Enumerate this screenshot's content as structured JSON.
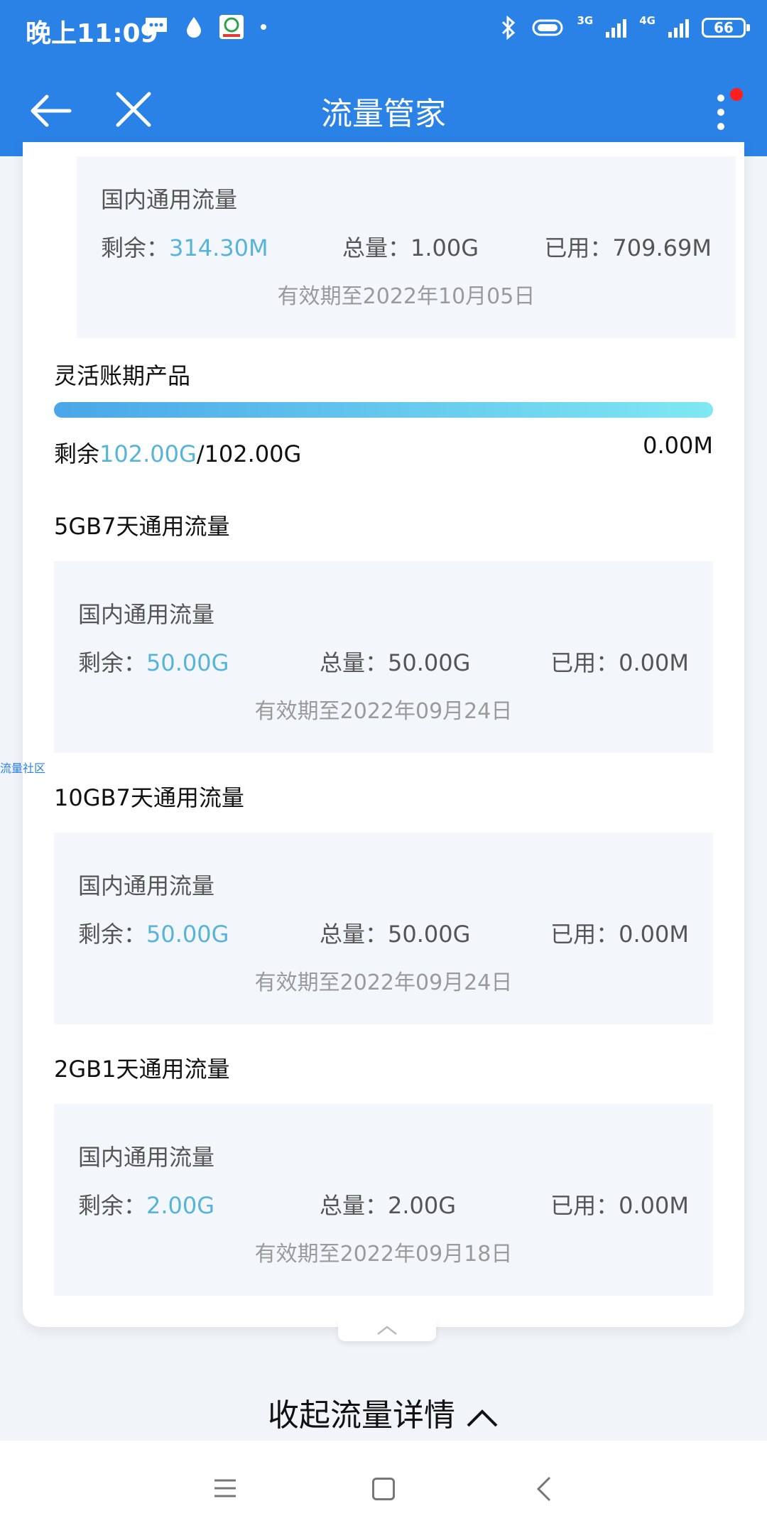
{
  "status_bar": {
    "time": "晚上11:09",
    "network_3g": "3G",
    "network_4g": "4G",
    "battery": "66",
    "icons": [
      "message-icon",
      "drop-icon",
      "app-notification-icon",
      "dot-icon",
      "bluetooth-icon",
      "vibrate-icon",
      "signal-3g-icon",
      "signal-4g-icon",
      "battery-icon"
    ]
  },
  "app_bar": {
    "title": "流量管家"
  },
  "top_package": {
    "type": "国内通用流量",
    "remain_label": "剩余：",
    "remain_value": "314.30M",
    "total": "总量：1.00G",
    "used": "已用：709.69M",
    "validity": "有效期至2022年10月05日"
  },
  "flex_product": {
    "title": "灵活账期产品",
    "progress_remaining_fraction": 1.0,
    "remain_label": "剩余",
    "remain_value": "102.00G",
    "remain_total": "/102.00G",
    "right_value": "0.00M"
  },
  "packages": [
    {
      "title": "5GB7天通用流量",
      "type": "国内通用流量",
      "remain_label": "剩余：",
      "remain_value": "50.00G",
      "total": "总量：50.00G",
      "used": "已用：0.00M",
      "validity": "有效期至2022年09月24日"
    },
    {
      "title": "10GB7天通用流量",
      "type": "国内通用流量",
      "remain_label": "剩余：",
      "remain_value": "50.00G",
      "total": "总量：50.00G",
      "used": "已用：0.00M",
      "validity": "有效期至2022年09月24日"
    },
    {
      "title": "2GB1天通用流量",
      "type": "国内通用流量",
      "remain_label": "剩余：",
      "remain_value": "2.00G",
      "total": "总量：2.00G",
      "used": "已用：0.00M",
      "validity": "有效期至2022年09月18日"
    }
  ],
  "side_tag": "流量社区",
  "collapse": {
    "label": "收起流量详情"
  }
}
